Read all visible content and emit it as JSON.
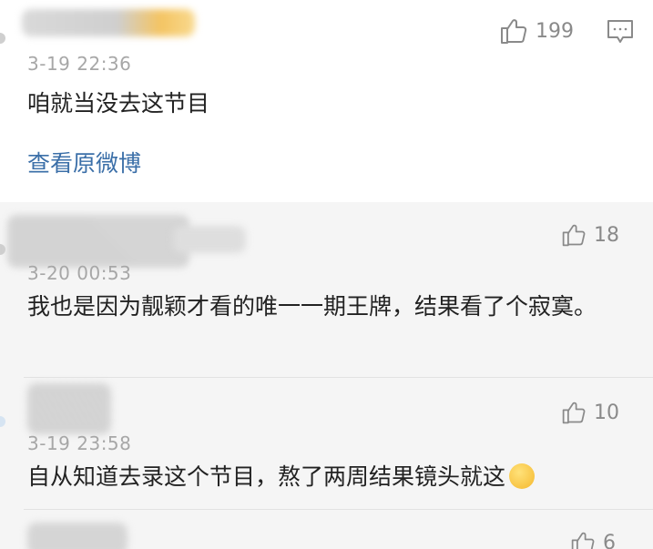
{
  "main_comment": {
    "timestamp": "3-19 22:36",
    "likes": "199",
    "text": "咱就当没去这节目",
    "view_original": "查看原微博"
  },
  "replies": [
    {
      "timestamp": "3-20 00:53",
      "likes": "18",
      "text": "我也是因为靓颖才看的唯一一期王牌，结果看了个寂寞。"
    },
    {
      "timestamp": "3-19 23:58",
      "likes": "10",
      "text": "自从知道去录这个节目，熬了两周结果镜头就这"
    },
    {
      "likes": "6"
    }
  ],
  "icons": {
    "like": "thumbs-up-icon",
    "reply": "comment-icon",
    "emoji": "relieved-face-emoji"
  },
  "colors": {
    "link": "#3b6fa8",
    "timestamp": "#a7a7a7",
    "reply_bg": "#f5f5f5"
  }
}
